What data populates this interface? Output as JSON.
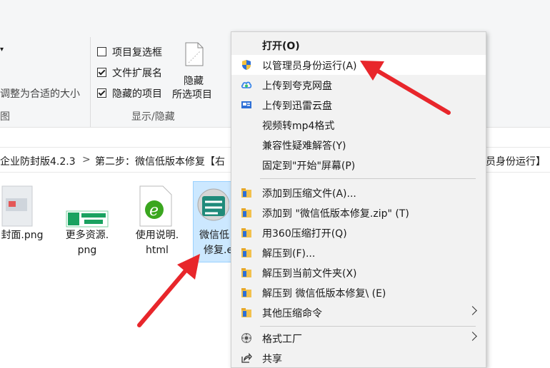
{
  "ribbon": {
    "fit_columns": "调整为合适的大小",
    "checkbox_item_checkboxes": "项目复选框",
    "checkbox_file_ext": "文件扩展名",
    "checkbox_hidden_items": "隐藏的项目",
    "item_checkboxes_checked": false,
    "file_ext_checked": true,
    "hidden_items_checked": true,
    "hide_selected_line1": "隐藏",
    "hide_selected_line2": "所选项目",
    "group_show_hide": "显示/隐藏",
    "group_left_fragment": "图"
  },
  "address_bar": {
    "seg1": "企业防封版4.2.3",
    "sep": ">",
    "seg2": "第二步：微信低版本修复【右",
    "seg2_tail": "员身份运行】"
  },
  "files": [
    {
      "name_line1": "封面.png",
      "name_line2": ""
    },
    {
      "name_line1": "更多资源.",
      "name_line2": "png"
    },
    {
      "name_line1": "使用说明.",
      "name_line2": "html"
    },
    {
      "name_line1": "微信低",
      "name_line2": "修复.e"
    }
  ],
  "context_menu": {
    "open": "打开(O)",
    "run_as_admin": "以管理员身份运行(A)",
    "upload_quark": "上传到夸克网盘",
    "upload_xunlei": "上传到迅雷云盘",
    "video_to_mp4": "视频转mp4格式",
    "compat_troubleshoot": "兼容性疑难解答(Y)",
    "pin_start": "固定到\"开始\"屏幕(P)",
    "add_to_archive": "添加到压缩文件(A)...",
    "add_to_zip": "添加到 \"微信低版本修复.zip\" (T)",
    "open_with_360": "用360压缩打开(Q)",
    "extract_to": "解压到(F)...",
    "extract_here": "解压到当前文件夹(X)",
    "extract_to_folder": "解压到 微信低版本修复\\ (E)",
    "other_compress": "其他压缩命令",
    "format_factory": "格式工厂",
    "share": "共享"
  },
  "colors": {
    "arrow_red": "#e8262b",
    "menu_bg": "#f2f2f2",
    "ribbon_bg": "#f5f6f7",
    "highlight": "#ffffff"
  },
  "icons": [
    "uac-shield-icon",
    "quark-cloud-icon",
    "xunlei-cloud-icon",
    "zip-archive-icon",
    "format-factory-icon",
    "share-icon",
    "submenu-arrow-icon"
  ]
}
